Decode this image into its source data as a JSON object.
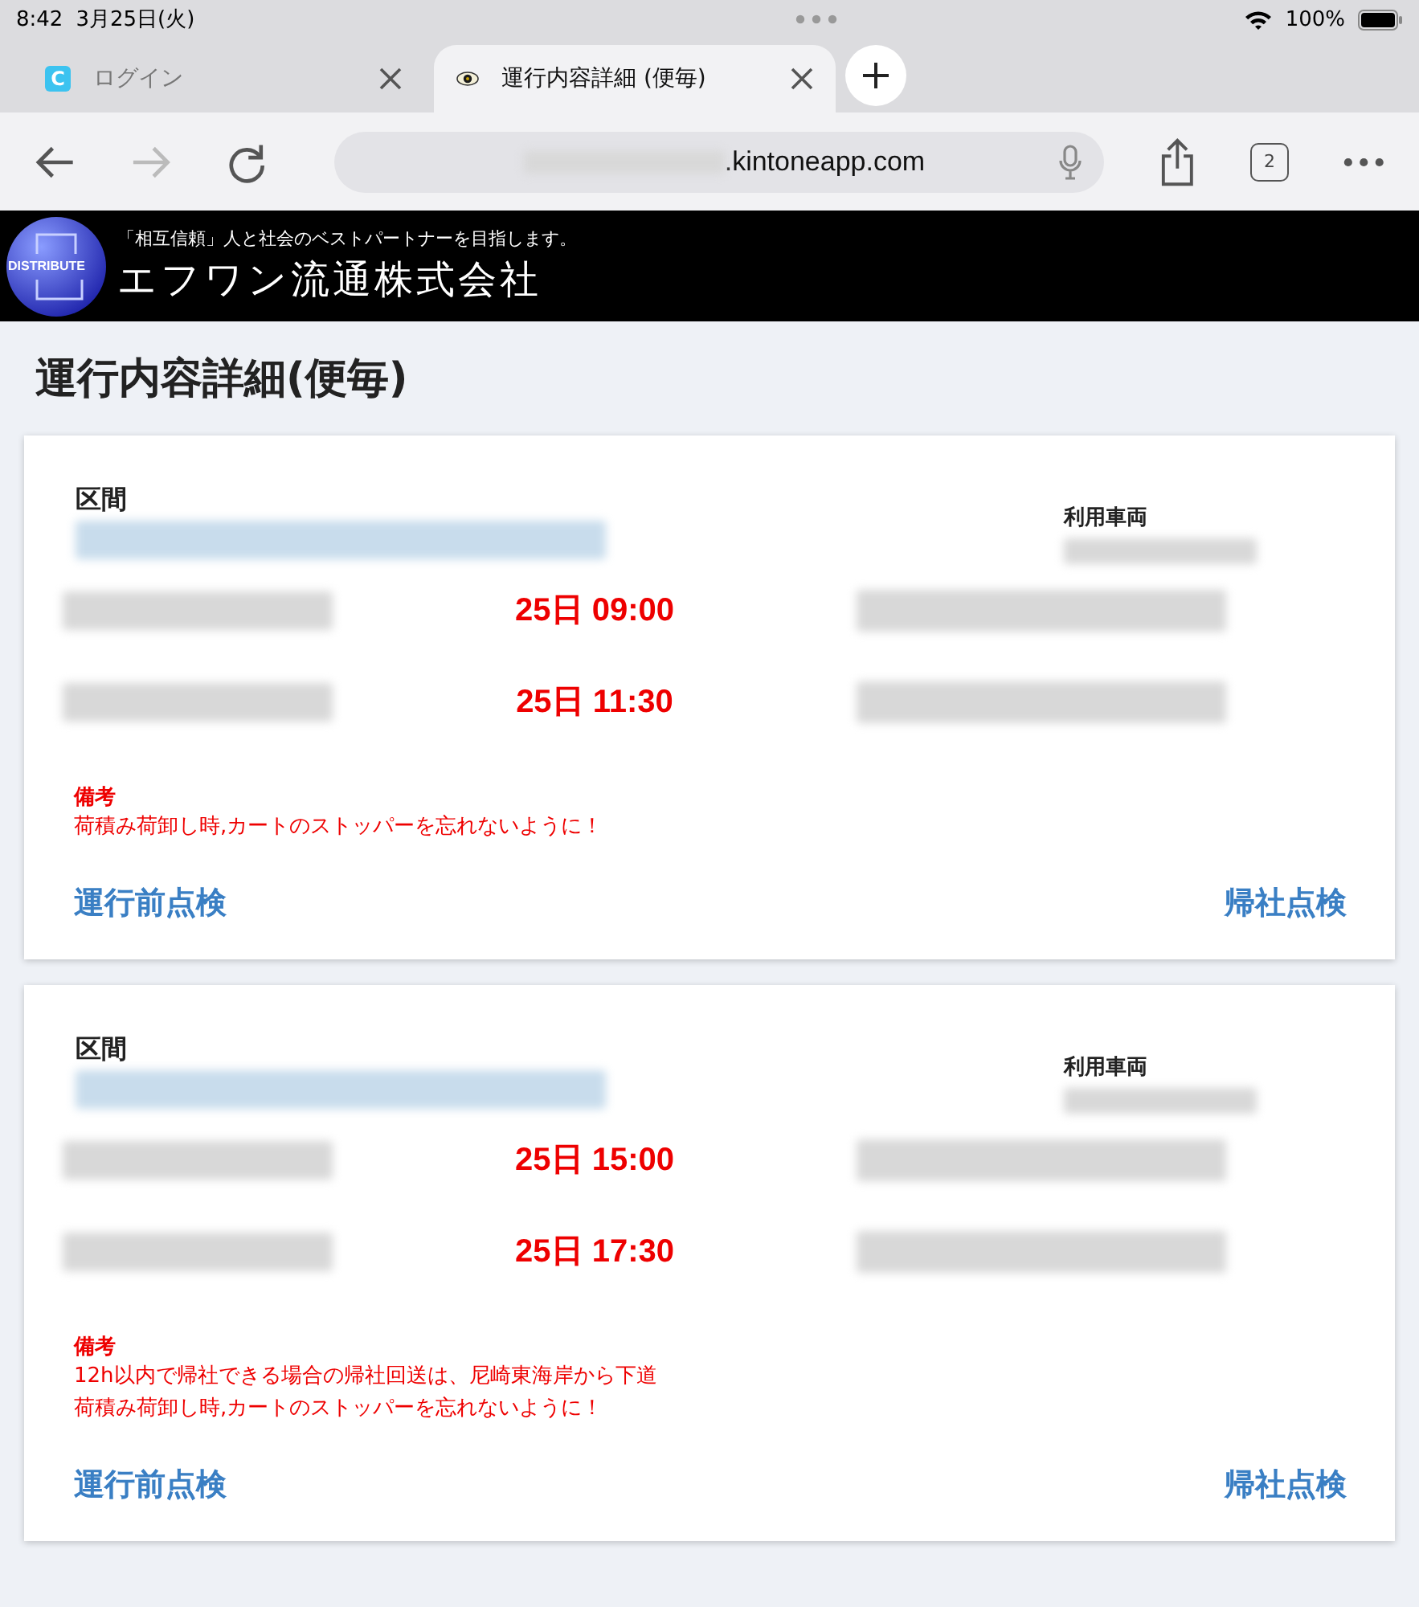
{
  "status_bar": {
    "time": "8:42",
    "date": "3月25日(火)",
    "battery": "100%"
  },
  "tabs": [
    {
      "title": "ログイン",
      "favicon": "C",
      "selected": false
    },
    {
      "title": "運行内容詳細 (便毎)",
      "selected": true
    }
  ],
  "address_bar": {
    "url": ".kintoneapp.com",
    "tab_count": "2"
  },
  "header": {
    "logo_text": "DISTRIBUTE",
    "slogan": "「相互信頼」人と社会のベストパートナーを目指します。",
    "company": "エフワン流通株式会社"
  },
  "page_title": "運行内容詳細(便毎)",
  "cards": [
    {
      "section_label": "区間",
      "vehicle_label": "利用車両",
      "times": [
        "25日 09:00",
        "25日 11:30"
      ],
      "notes_label": "備考",
      "notes": [
        "荷積み荷卸し時,カートのストッパーを忘れないように！"
      ],
      "links": [
        "運行前点検",
        "帰社点検"
      ]
    },
    {
      "section_label": "区間",
      "vehicle_label": "利用車両",
      "times": [
        "25日 15:00",
        "25日 17:30"
      ],
      "notes_label": "備考",
      "notes": [
        "12h以内で帰社できる場合の帰社回送は、尼崎東海岸から下道",
        "荷積み荷卸し時,カートのストッパーを忘れないように！"
      ],
      "links": [
        "運行前点検",
        "帰社点検"
      ]
    }
  ]
}
